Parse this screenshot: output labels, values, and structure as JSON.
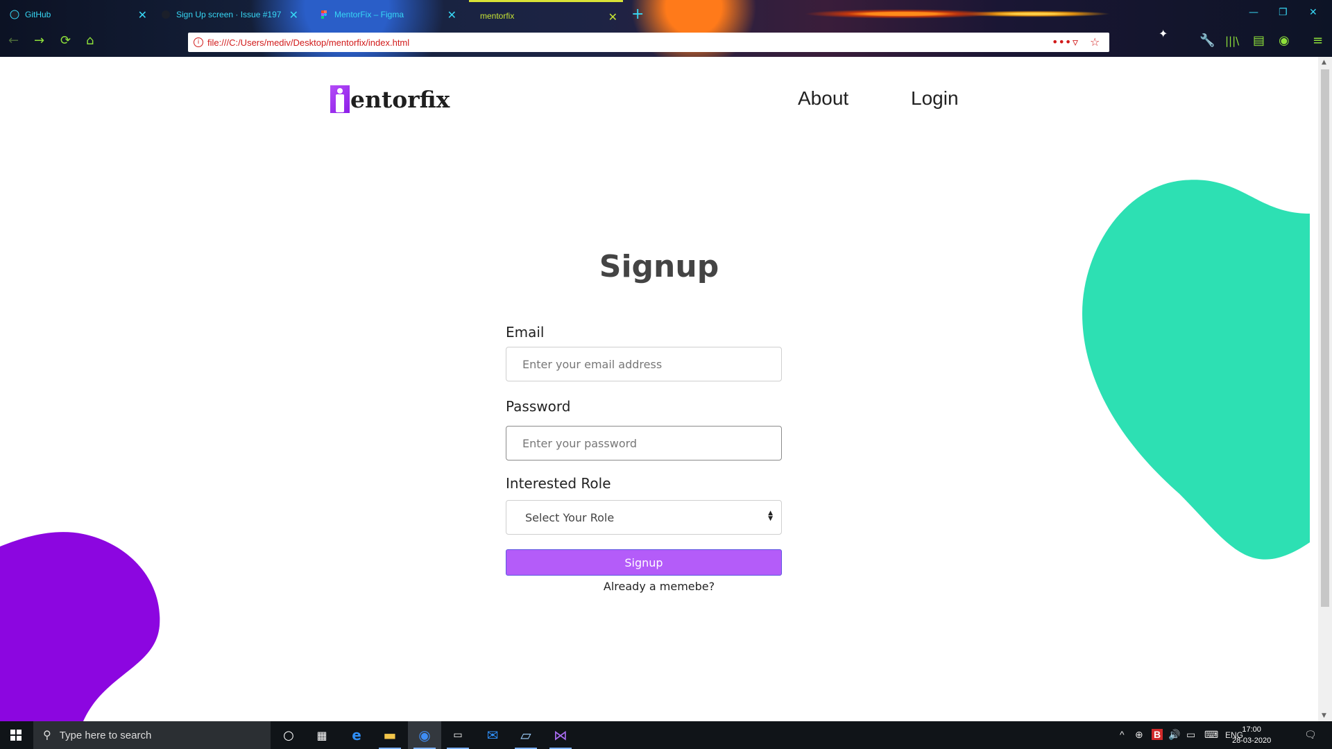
{
  "browser": {
    "tabs": [
      {
        "label": "GitHub",
        "icon": "github-icon"
      },
      {
        "label": "Sign Up screen · Issue #197",
        "icon": "github-icon"
      },
      {
        "label": "MentorFix – Figma",
        "icon": "figma-icon"
      },
      {
        "label": "mentorfix",
        "icon": "page-icon",
        "active": true
      }
    ],
    "new_tab": "+",
    "url": "file:///C:/Users/mediv/Desktop/mentorfix/index.html"
  },
  "navbar": {
    "logo_letter": "M",
    "logo_text": "entorfix",
    "links": [
      "About",
      "Login"
    ]
  },
  "form": {
    "title": "Signup",
    "email_label": "Email",
    "email_placeholder": "Enter your email address",
    "password_label": "Password",
    "password_placeholder": "Enter your password",
    "role_label": "Interested Role",
    "role_selected": "Select Your Role",
    "submit_label": "Signup",
    "already_member": "Already a memebe?"
  },
  "colors": {
    "teal_blob": "#2de0b3",
    "purple_blob": "#8c06e0",
    "button": "#b45cf9",
    "url_text": "#d11a1a"
  },
  "taskbar": {
    "search_placeholder": "Type here to search",
    "language": "ENG",
    "time": "17:00",
    "date": "28-03-2020"
  }
}
